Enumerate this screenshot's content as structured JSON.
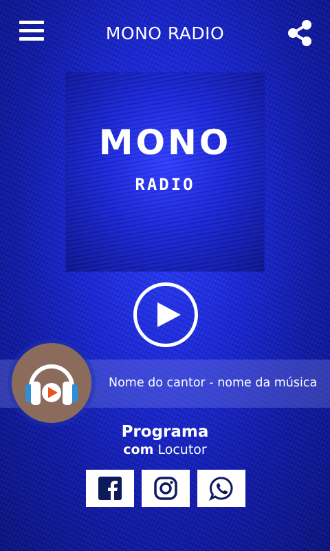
{
  "header": {
    "title": "MONO RADIO",
    "menu_icon": "hamburger-menu-icon",
    "share_icon": "share-icon"
  },
  "cover": {
    "logo_main": "MONO",
    "logo_sub": "RADIO"
  },
  "player": {
    "play_icon": "play-icon",
    "now_playing": "Nome do cantor - nome da música"
  },
  "program": {
    "title": "Programa",
    "host_prefix": "com",
    "host_name": "Locutor"
  },
  "socials": [
    {
      "name": "facebook-icon"
    },
    {
      "name": "instagram-icon"
    },
    {
      "name": "whatsapp-icon"
    }
  ],
  "colors": {
    "background": "#1a27d8",
    "avatar_bg": "#8b6c5c",
    "icon_dark": "#0d1a5c",
    "headphone_blue": "#2e8fd8",
    "play_orange": "#e8541e"
  }
}
